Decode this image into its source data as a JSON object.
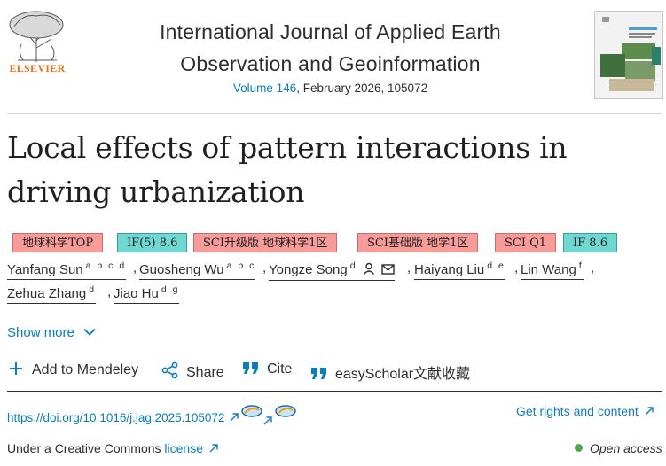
{
  "header": {
    "publisher": "ELSEVIER",
    "journal_title_line1": "International Journal of Applied Earth",
    "journal_title_line2": "Observation and Geoinformation",
    "volume": "Volume 146",
    "issue_info": ", February 2026, 105072",
    "cover_title": "APPLIED EARTH OBSERVATION AND GEOINFORMATION"
  },
  "article": {
    "title_line1": "Local effects of pattern interactions in",
    "title_line2": "driving urbanization"
  },
  "badges": [
    {
      "label": "地球科学TOP",
      "color": "#f79c99"
    },
    {
      "label": "IF(5) 8.6",
      "color": "#6fd8d3"
    },
    {
      "label": "SCI升级版 地球科学1区",
      "color": "#f79c99"
    },
    {
      "label": "SCI基础版 地学1区",
      "color": "#f79c99"
    },
    {
      "label": "SCI Q1",
      "color": "#f79c99"
    },
    {
      "label": "IF 8.6",
      "color": "#6fd8d3"
    }
  ],
  "authors": [
    {
      "name": "Yanfang Sun",
      "aff": "a b c d"
    },
    {
      "name": "Guosheng Wu",
      "aff": "a b c"
    },
    {
      "name": "Yongze Song",
      "aff": "d"
    },
    {
      "name": "Haiyang Liu",
      "aff": "d e"
    },
    {
      "name": "Lin Wang",
      "aff": "f"
    },
    {
      "name": "Zehua Zhang",
      "aff": "d"
    },
    {
      "name": "Jiao Hu",
      "aff": "d g"
    }
  ],
  "show_more": "Show more",
  "toolbar": {
    "mendeley": "Add to Mendeley",
    "share": "Share",
    "cite": "Cite",
    "easyscholar": "easyScholar文献收藏"
  },
  "doi": "https://doi.org/10.1016/j.jag.2025.105072",
  "rights": "Get rights and content",
  "license_prefix": "Under a Creative Commons ",
  "license_link": "license",
  "open_access": "Open access",
  "colors": {
    "link": "#0c7dbb",
    "publisher": "#e9711c",
    "open_access_dot": "#4aab4f"
  },
  "icons": [
    "elsevier-tree-logo",
    "journal-cover",
    "person-icon",
    "mail-icon",
    "plus-icon",
    "share-icon",
    "quote-icon",
    "chevron-down-icon",
    "external-arrow-icon"
  ]
}
